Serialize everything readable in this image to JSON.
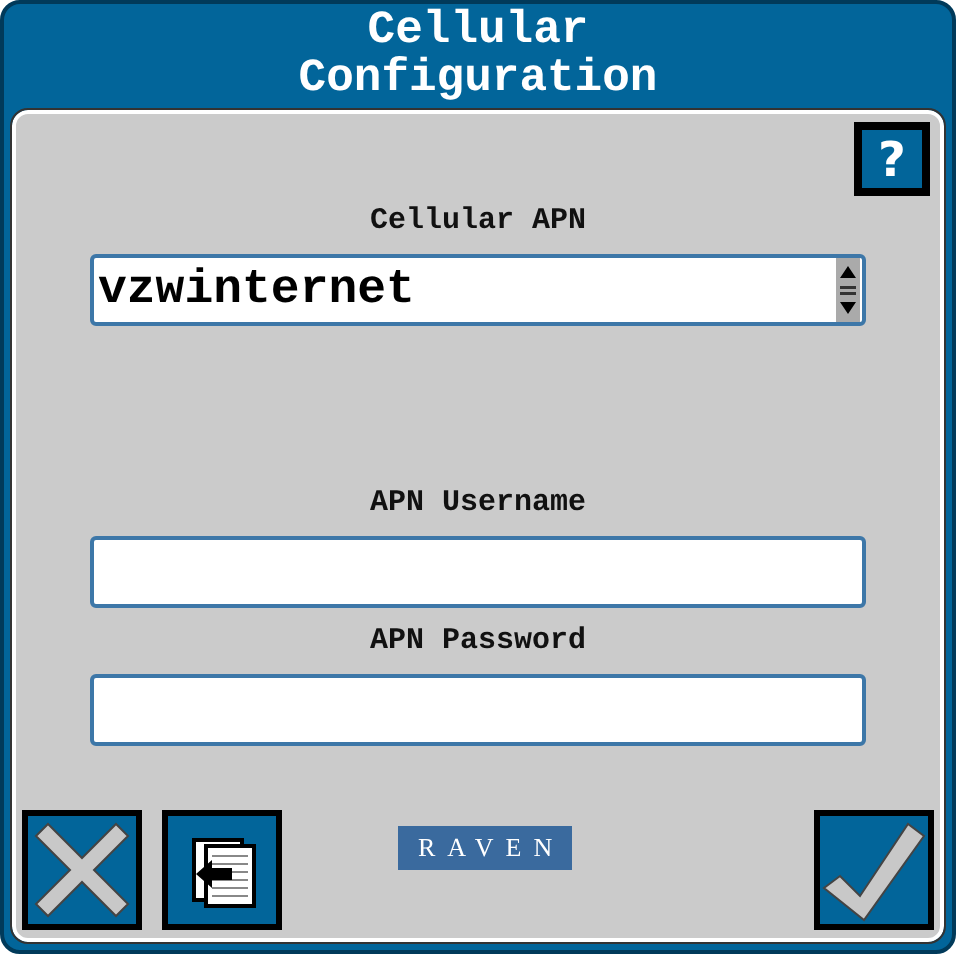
{
  "window": {
    "title_lines": [
      "Cellular",
      "Configuration"
    ]
  },
  "help_button": {
    "label": "?"
  },
  "fields": [
    {
      "label": "Cellular APN",
      "value": "vzwinternet",
      "kind": "spinner"
    },
    {
      "label": "APN Username",
      "kind": "text"
    },
    {
      "label": "APN Password",
      "kind": "text"
    }
  ],
  "logo": {
    "text": "RAVEN"
  }
}
